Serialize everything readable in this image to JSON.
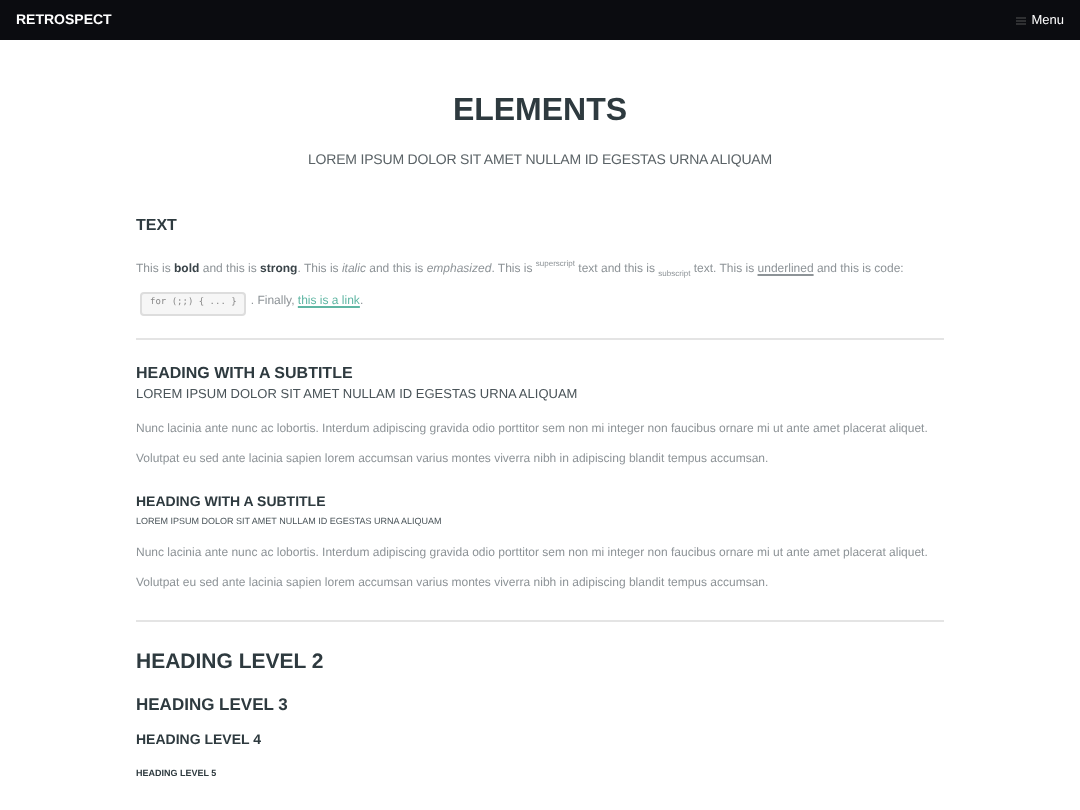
{
  "navbar": {
    "brand": "RETROSPECT",
    "menu": "Menu"
  },
  "header": {
    "title": "ELEMENTS",
    "subtitle": "LOREM IPSUM DOLOR SIT AMET NULLAM ID EGESTAS URNA ALIQUAM"
  },
  "text_section": {
    "heading": "TEXT",
    "paragraph": [
      {
        "kind": "text",
        "text": "This is **bold** and this is **strong**. This is *italic* and this is *emphasized*. This is $^{superscript}$ text and this is $_{subscript}$ text. This is "
      },
      {
        "kind": "underline",
        "text": "underlined"
      },
      {
        "kind": "text",
        "text": " and this is code: "
      },
      {
        "kind": "code",
        "text": "for (;;) { ... }"
      },
      {
        "kind": "text",
        "text": ". Finally, "
      },
      {
        "kind": "link",
        "text": "this is a link"
      },
      {
        "kind": "text",
        "text": "."
      }
    ]
  },
  "subtitle_sections": [
    {
      "heading": "HEADING WITH A SUBTITLE",
      "subtitle": "LOREM IPSUM DOLOR SIT AMET NULLAM ID EGESTAS URNA ALIQUAM",
      "kind": "large",
      "body": "Nunc lacinia ante nunc ac lobortis. Interdum adipiscing gravida odio porttitor sem non mi integer non faucibus ornare mi ut ante amet placerat aliquet. Volutpat eu sed ante lacinia sapien lorem accumsan varius montes viverra nibh in adipiscing blandit tempus accumsan."
    },
    {
      "heading": "HEADING WITH A SUBTITLE",
      "subtitle": "LOREM IPSUM DOLOR SIT AMET NULLAM ID EGESTAS URNA ALIQUAM",
      "kind": "small",
      "body": "Nunc lacinia ante nunc ac lobortis. Interdum adipiscing gravida odio porttitor sem non mi integer non faucibus ornare mi ut ante amet placerat aliquet. Volutpat eu sed ante lacinia sapien lorem accumsan varius montes viverra nibh in adipiscing blandit tempus accumsan."
    }
  ],
  "headings": [
    {
      "kind": "h2",
      "text": "HEADING LEVEL 2"
    },
    {
      "kind": "h3",
      "text": "HEADING LEVEL 3"
    },
    {
      "kind": "h4",
      "text": "HEADING LEVEL 4"
    },
    {
      "kind": "h5",
      "text": "HEADING LEVEL 5"
    }
  ]
}
